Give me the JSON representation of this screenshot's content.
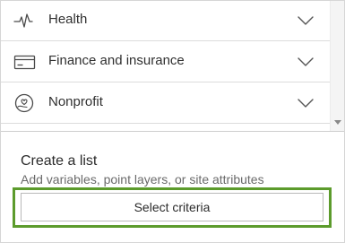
{
  "categories": [
    {
      "label": "Health",
      "icon": "heartbeat-icon"
    },
    {
      "label": "Finance and insurance",
      "icon": "credit-card-icon"
    },
    {
      "label": "Nonprofit",
      "icon": "hand-heart-icon"
    }
  ],
  "create_list": {
    "title": "Create a list",
    "subtitle": "Add variables, point layers, or site attributes",
    "button_label": "Select criteria"
  },
  "colors": {
    "highlight": "#5c9b2c",
    "text": "#303030",
    "divider": "#dcdcdc"
  }
}
